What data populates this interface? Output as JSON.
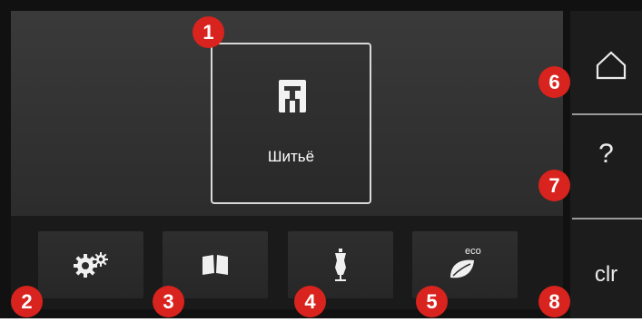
{
  "main": {
    "sewing_tile": {
      "label": "Шитьё",
      "icon": "presser-foot-icon"
    }
  },
  "bottom_buttons": [
    {
      "name": "setup-button",
      "icon": "gears-icon"
    },
    {
      "name": "tutorial-button",
      "icon": "open-book-icon"
    },
    {
      "name": "sewing-consultant-button",
      "icon": "dress-form-icon"
    },
    {
      "name": "eco-mode-button",
      "icon": "eco-leaf-icon",
      "icon_text": "eco"
    }
  ],
  "side_buttons": {
    "home": {
      "icon": "home-icon"
    },
    "help": {
      "label": "?"
    },
    "clear": {
      "label": "clr"
    }
  },
  "callouts": [
    "1",
    "2",
    "3",
    "4",
    "5",
    "6",
    "7",
    "8"
  ],
  "colors": {
    "callout": "#d8231e",
    "background": "#111111",
    "panel": "#353535",
    "text": "#ffffff"
  }
}
